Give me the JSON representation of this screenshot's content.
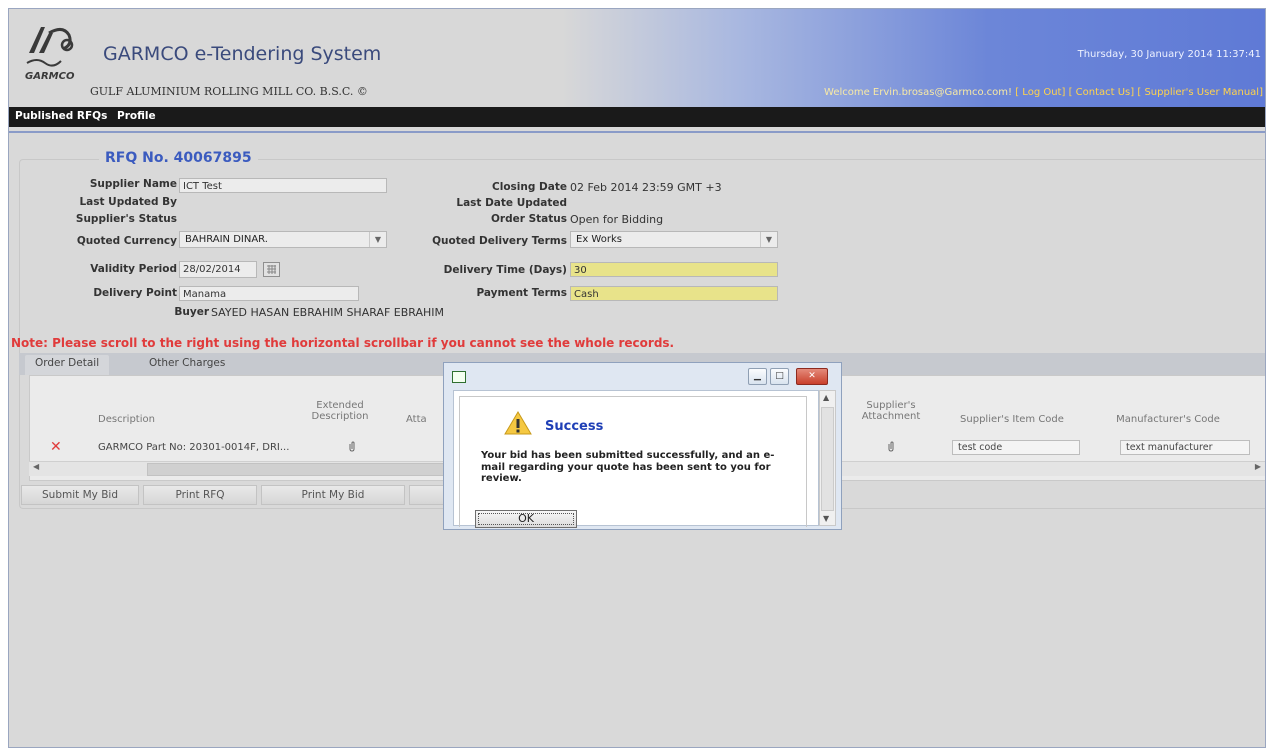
{
  "header": {
    "title": "GARMCO e-Tendering System",
    "subtitle": "GULF ALUMINIUM ROLLING MILL CO. B.S.C. ©",
    "logo_text": "GARMCO",
    "datetime": "Thursday, 30 January 2014 11:37:41",
    "welcome": "Welcome Ervin.brosas@Garmco.com!",
    "links": [
      "[ Log Out]",
      "[ Contact Us]",
      "[ Supplier's User Manual]"
    ]
  },
  "nav": {
    "items": [
      "Published RFQs",
      "Profile"
    ]
  },
  "rfq": {
    "title": "RFQ No. 40067895",
    "supplier_name_label": "Supplier Name",
    "supplier_name": "ICT Test",
    "last_updated_by_label": "Last Updated By",
    "supplier_status_label": "Supplier's Status",
    "closing_date_label": "Closing Date",
    "closing_date": "02 Feb 2014 23:59 GMT +3",
    "last_date_updated_label": "Last Date Updated",
    "order_status_label": "Order Status",
    "order_status": "Open for Bidding",
    "quoted_currency_label": "Quoted Currency",
    "quoted_currency": "BAHRAIN DINAR.",
    "quoted_delivery_terms_label": "Quoted Delivery Terms",
    "quoted_delivery_terms": "Ex Works",
    "validity_period_label": "Validity Period",
    "validity_period": "28/02/2014",
    "delivery_time_label": "Delivery Time (Days)",
    "delivery_time": "30",
    "delivery_point_label": "Delivery Point",
    "delivery_point": "Manama",
    "payment_terms_label": "Payment Terms",
    "payment_terms": "Cash",
    "buyer_label": "Buyer",
    "buyer": "SAYED HASAN EBRAHIM SHARAF EBRAHIM"
  },
  "note": "Note: Please scroll to the right using the horizontal scrollbar if you cannot see the whole records.",
  "tabs": [
    "Order Detail",
    "Other Charges"
  ],
  "grid": {
    "col_description": "Description",
    "col_extended_line1": "Extended",
    "col_extended_line2": "Description",
    "col_attach_partial": "Atta",
    "col_supplier_attach_line1": "Supplier's",
    "col_supplier_attach_line2": "Attachment",
    "col_item_code": "Supplier's Item Code",
    "col_manufacturer_code": "Manufacturer's Code",
    "row_description": "GARMCO Part No: 20301-0014F, DRI...",
    "row_item_code": "test code",
    "row_manufacturer_code": "text manufacturer"
  },
  "buttons": [
    "Submit My Bid",
    "Print RFQ",
    "Print My Bid"
  ],
  "dialog": {
    "heading": "Success",
    "message": "Your bid has been submitted successfully, and an e-mail regarding your quote has been sent to you for review.",
    "ok_label": "OK"
  },
  "colors": {
    "brand_blue": "#3b5bbf",
    "note_red": "#e03b3b",
    "highlight_yellow": "#e8e38a",
    "nav_black": "#1a1a1a"
  }
}
